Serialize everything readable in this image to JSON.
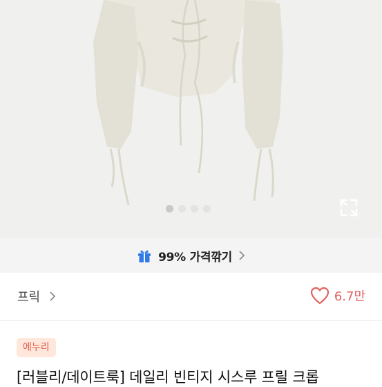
{
  "product_image": {
    "alt": "",
    "carousel_total": 4,
    "carousel_active": 1
  },
  "promo": {
    "icon": "gift-icon",
    "text": "99% 가격깎기",
    "accent": "#1a73e8"
  },
  "seller": {
    "name": "프릭",
    "likes_count": "6.7만",
    "like_color": "#e2615e"
  },
  "product": {
    "badge": "에누리",
    "badge_color": "#e05c46",
    "title": "[러블리/데이트룩] 데일리 빈티지 시스루 프릴 크롭"
  }
}
